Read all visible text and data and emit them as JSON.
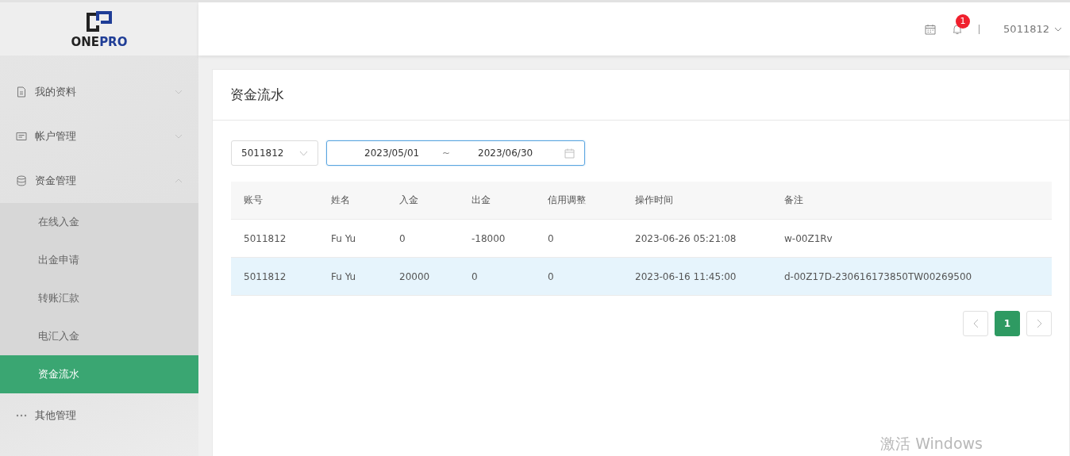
{
  "logo": {
    "parts": [
      {
        "text": "ONE",
        "color": "#222222"
      },
      {
        "text": "PRO",
        "color": "#1f3d96"
      }
    ]
  },
  "header": {
    "notification_count": "1",
    "user": "5011812"
  },
  "sidebar": {
    "items": [
      {
        "label": "我的资料",
        "kind": "document",
        "expanded": false
      },
      {
        "label": "帐户管理",
        "kind": "card",
        "expanded": false
      },
      {
        "label": "资金管理",
        "kind": "database",
        "expanded": true,
        "children": [
          {
            "label": "在线入金",
            "selected": false
          },
          {
            "label": "出金申请",
            "selected": false
          },
          {
            "label": "转账汇款",
            "selected": false
          },
          {
            "label": "电汇入金",
            "selected": false
          },
          {
            "label": "资金流水",
            "selected": true
          }
        ]
      },
      {
        "label": "其他管理",
        "kind": "more"
      }
    ]
  },
  "page_title": "资金流水",
  "filters": {
    "account": "5011812",
    "date_start": "2023/05/01",
    "date_separator": "~",
    "date_end": "2023/06/30",
    "date_focused": true
  },
  "table": {
    "columns": [
      "账号",
      "姓名",
      "入金",
      "出金",
      "信用调整",
      "操作时间",
      "备注"
    ],
    "rows": [
      {
        "cells": [
          "5011812",
          "Fu Yu",
          "0",
          "-18000",
          "0",
          "2023-06-26 05:21:08",
          "w-00Z1Rv"
        ],
        "selected": false
      },
      {
        "cells": [
          "5011812",
          "Fu Yu",
          "20000",
          "0",
          "0",
          "2023-06-16 11:45:00",
          "d-00Z17D-230616173850TW00269500"
        ],
        "selected": true
      }
    ]
  },
  "pagination": {
    "pages": [
      {
        "label": "1",
        "selected": true
      }
    ]
  },
  "os_notice": "激活 Windows"
}
